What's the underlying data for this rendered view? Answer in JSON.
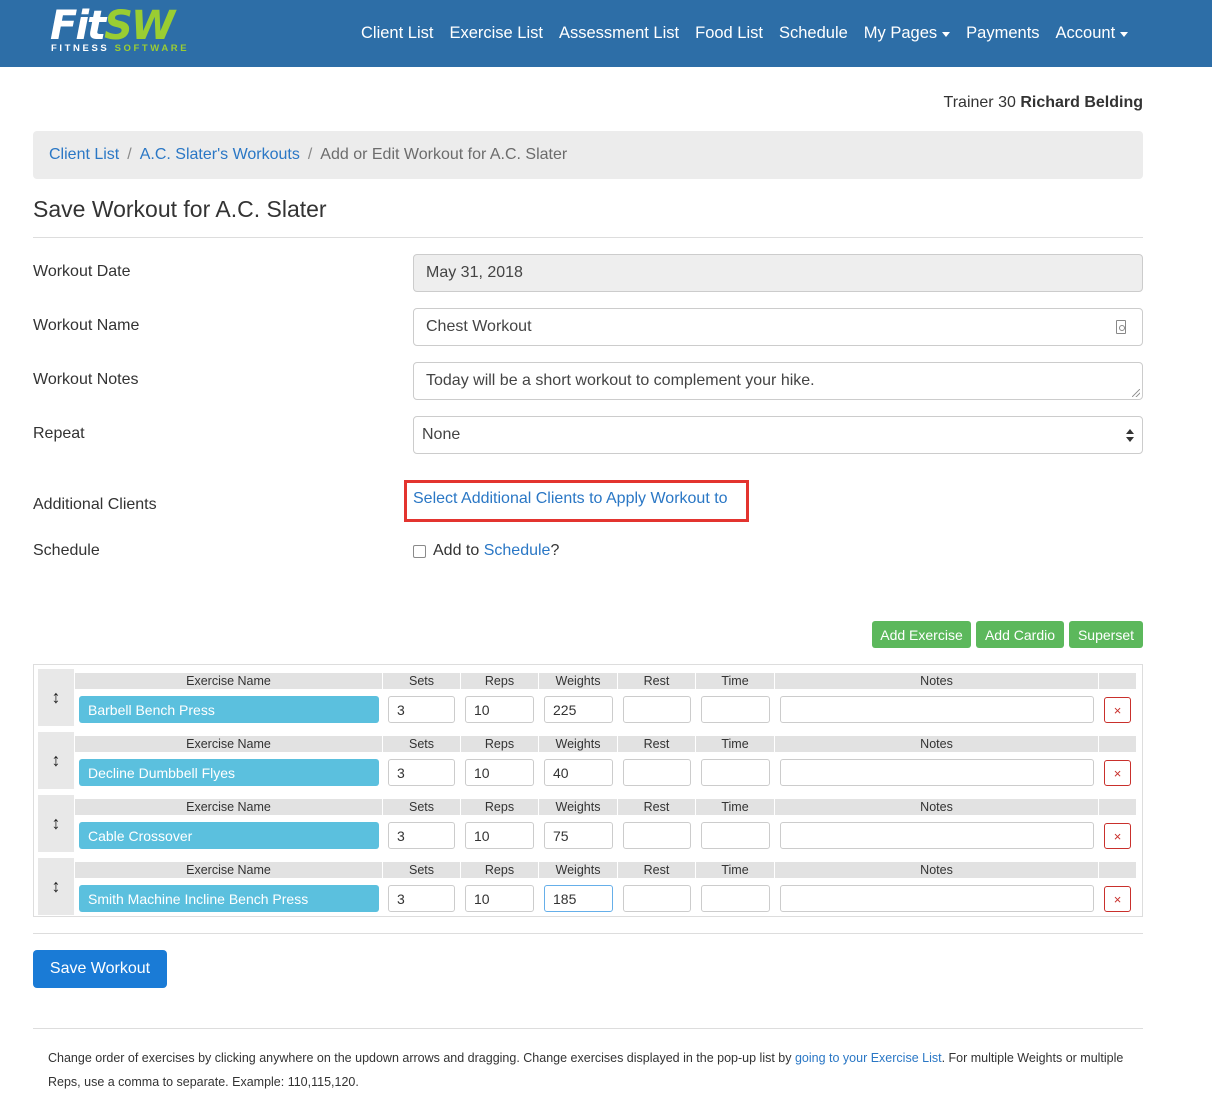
{
  "logo": {
    "text_main": "Fit",
    "text_accent": "SW",
    "sub_main": "FITNESS ",
    "sub_accent": "SOFTWARE"
  },
  "nav": {
    "client_list": "Client List",
    "exercise_list": "Exercise List",
    "assessment_list": "Assessment List",
    "food_list": "Food List",
    "schedule": "Schedule",
    "my_pages": "My Pages",
    "payments": "Payments",
    "account": "Account"
  },
  "trainer": {
    "prefix": "Trainer 30",
    "name": "Richard Belding"
  },
  "breadcrumb": {
    "item1": "Client List",
    "item2": "A.C. Slater's Workouts",
    "current": "Add or Edit Workout for A.C. Slater",
    "separator": "/"
  },
  "page_title": "Save Workout for A.C. Slater",
  "form": {
    "date_label": "Workout Date",
    "date_value": "May 31, 2018",
    "name_label": "Workout Name",
    "name_value": "Chest Workout",
    "notes_label": "Workout Notes",
    "notes_value": "Today will be a short workout to complement your hike.",
    "repeat_label": "Repeat",
    "repeat_value": "None",
    "additional_label": "Additional Clients",
    "additional_link": "Select Additional Clients to Apply Workout to",
    "schedule_label": "Schedule",
    "schedule_prefix": "Add to ",
    "schedule_link": "Schedule",
    "schedule_suffix": "?"
  },
  "actions": {
    "add_exercise": "Add Exercise",
    "add_cardio": "Add Cardio",
    "superset": "Superset"
  },
  "columns": {
    "name": "Exercise Name",
    "sets": "Sets",
    "reps": "Reps",
    "weights": "Weights",
    "rest": "Rest",
    "time": "Time",
    "notes": "Notes"
  },
  "exercises": [
    {
      "name": "Barbell Bench Press",
      "sets": "3",
      "reps": "10",
      "weights": "225",
      "rest": "",
      "time": "",
      "notes": ""
    },
    {
      "name": "Decline Dumbbell Flyes",
      "sets": "3",
      "reps": "10",
      "weights": "40",
      "rest": "",
      "time": "",
      "notes": ""
    },
    {
      "name": "Cable Crossover",
      "sets": "3",
      "reps": "10",
      "weights": "75",
      "rest": "",
      "time": "",
      "notes": ""
    },
    {
      "name": "Smith Machine Incline Bench Press",
      "sets": "3",
      "reps": "10",
      "weights": "185",
      "rest": "",
      "time": "",
      "notes": ""
    }
  ],
  "drag_glyph": "↕",
  "delete_glyph": "×",
  "save_button": "Save Workout",
  "footer": {
    "text1": "Change order of exercises by clicking anywhere on the updown arrows and dragging. Change exercises displayed in the pop-up list by ",
    "link": "going to your Exercise List",
    "text2": ". For multiple Weights or multiple Reps, use a comma to separate. Example: 110,115,120."
  },
  "colors": {
    "navbar": "#2d6ea7",
    "link": "#2a77c5",
    "primary_button": "#1a7bd6",
    "success_button": "#5cb85c",
    "exercise_button": "#5bc0de",
    "highlight_border": "#e3342f",
    "danger": "#c9302c"
  }
}
